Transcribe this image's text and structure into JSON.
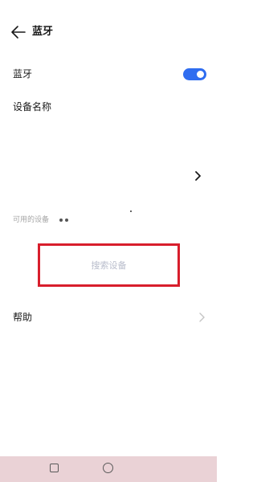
{
  "header": {
    "title": "蓝牙",
    "back_icon": "arrow-left-icon"
  },
  "bluetooth": {
    "label": "蓝牙",
    "enabled": true,
    "toggle_color": "#2f6df0"
  },
  "device_name": {
    "label": "设备名称",
    "chevron_icon": "chevron-right-icon"
  },
  "available_devices": {
    "label": "可用的设备",
    "scanning_icon": "loading-dots-icon"
  },
  "search": {
    "label": "搜索设备",
    "highlight_color": "#d81e2c"
  },
  "help": {
    "label": "帮助",
    "chevron_icon": "chevron-right-icon"
  },
  "navbar": {
    "background": "#ead2d6",
    "recent_icon": "square-icon",
    "home_icon": "circle-icon"
  }
}
